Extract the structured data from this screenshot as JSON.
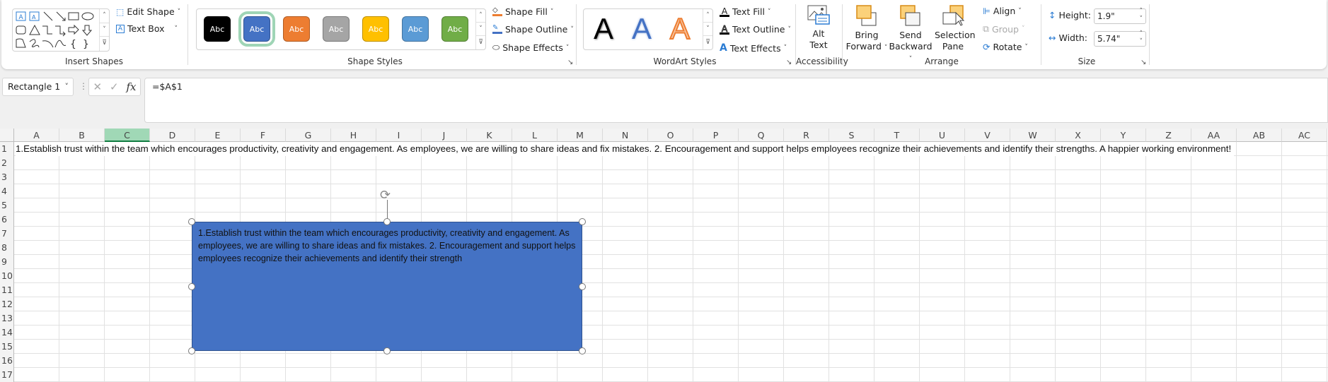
{
  "ribbon": {
    "insert_shapes": {
      "label": "Insert Shapes",
      "edit_shape": "Edit Shape",
      "text_box": "Text Box",
      "shape_icons": [
        "text-box",
        "vertical-text-box",
        "line",
        "arrow",
        "rectangle",
        "oval",
        "rounded-rectangle",
        "triangle",
        "elbow-connector",
        "elbow-arrow-connector",
        "right-arrow",
        "down-arrow",
        "freeform",
        "scribble",
        "arc",
        "curve",
        "left-brace",
        "right-brace"
      ]
    },
    "shape_styles": {
      "label": "Shape Styles",
      "swatches": [
        {
          "text": "Abc",
          "color": "#000000"
        },
        {
          "text": "Abc",
          "color": "#4472c4",
          "selected": true
        },
        {
          "text": "Abc",
          "color": "#ed7d31"
        },
        {
          "text": "Abc",
          "color": "#a5a5a5"
        },
        {
          "text": "Abc",
          "color": "#ffc000"
        },
        {
          "text": "Abc",
          "color": "#5b9bd5"
        },
        {
          "text": "Abc",
          "color": "#70ad47"
        }
      ],
      "shape_fill": "Shape Fill",
      "shape_outline": "Shape Outline",
      "shape_effects": "Shape Effects"
    },
    "wordart_styles": {
      "label": "WordArt Styles",
      "samples": [
        "A",
        "A",
        "A"
      ],
      "text_fill": "Text Fill",
      "text_outline": "Text Outline",
      "text_effects": "Text Effects"
    },
    "accessibility": {
      "label": "Accessibility",
      "alt_text_line1": "Alt",
      "alt_text_line2": "Text"
    },
    "arrange": {
      "label": "Arrange",
      "bring_forward_1": "Bring",
      "bring_forward_2": "Forward",
      "send_backward_1": "Send",
      "send_backward_2": "Backward",
      "selection_pane_1": "Selection",
      "selection_pane_2": "Pane",
      "align": "Align",
      "group": "Group",
      "rotate": "Rotate"
    },
    "size": {
      "label": "Size",
      "height_label": "Height:",
      "height_value": "1.9\"",
      "width_label": "Width:",
      "width_value": "5.74\""
    }
  },
  "formula_bar": {
    "name_box": "Rectangle 1",
    "cancel": "✕",
    "enter": "✓",
    "fx": "fx",
    "formula": "=$A$1"
  },
  "sheet": {
    "columns": [
      "A",
      "B",
      "C",
      "D",
      "E",
      "F",
      "G",
      "H",
      "I",
      "J",
      "K",
      "L",
      "M",
      "N",
      "O",
      "P",
      "Q",
      "R",
      "S",
      "T",
      "U",
      "V",
      "W",
      "X",
      "Y",
      "Z",
      "AA",
      "AB",
      "AC"
    ],
    "selected_column": "C",
    "rows": [
      "1",
      "2",
      "3",
      "4",
      "5",
      "6",
      "7",
      "8",
      "9",
      "10",
      "11",
      "12",
      "13",
      "14",
      "15",
      "16",
      "17"
    ],
    "cell_a1": "1.Establish trust within the team which encourages productivity, creativity and engagement. As employees, we are willing to share ideas and fix mistakes. 2. Encouragement and support helps employees recognize their achievements and identify their strengths. A happier working environment!"
  },
  "shape": {
    "name": "Rectangle 1",
    "fill": "#4472c4",
    "text": "1.Establish trust within the team which encourages productivity, creativity and engagement. As employees, we are willing to share ideas and fix mistakes. 2. Encouragement and support helps employees recognize their achievements and identify their strength"
  }
}
